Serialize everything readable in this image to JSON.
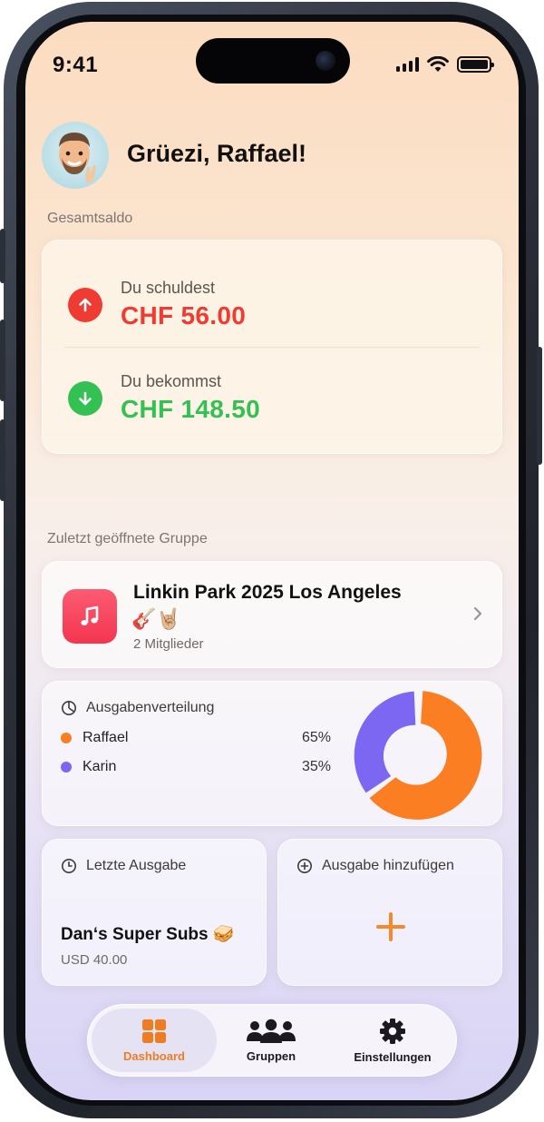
{
  "status_bar": {
    "time": "9:41"
  },
  "header": {
    "greeting": "Grüezi, Raffael!"
  },
  "balance": {
    "section_label": "Gesamtsaldo",
    "owe_label": "Du schuldest",
    "owe_amount": "CHF 56.00",
    "receive_label": "Du bekommst",
    "receive_amount": "CHF 148.50",
    "colors": {
      "owe": "#f03b32",
      "receive": "#34c153"
    }
  },
  "recent_group": {
    "section_label": "Zuletzt geöffnete Gruppe",
    "title": "Linkin Park 2025 Los Angeles",
    "emoji": "🎸🤘🏼",
    "members": "2 Mitglieder",
    "icon": "music-note-icon"
  },
  "distribution": {
    "title": "Ausgabenverteilung",
    "people": [
      {
        "name": "Raffael",
        "percent": "65%",
        "color": "#fb7f22"
      },
      {
        "name": "Karin",
        "percent": "35%",
        "color": "#7b67f2"
      }
    ]
  },
  "last_expense": {
    "title": "Letzte Ausgabe",
    "name": "Dan‘s Super Subs 🥪",
    "amount": "USD 40.00"
  },
  "add_expense": {
    "title": "Ausgabe hinzufügen",
    "accent": "#f38a2c"
  },
  "tabbar": {
    "active": "Dashboard",
    "tabs": [
      {
        "label": "Dashboard",
        "icon": "grid-icon"
      },
      {
        "label": "Gruppen",
        "icon": "people-icon"
      },
      {
        "label": "Einstellungen",
        "icon": "gear-icon"
      }
    ]
  }
}
